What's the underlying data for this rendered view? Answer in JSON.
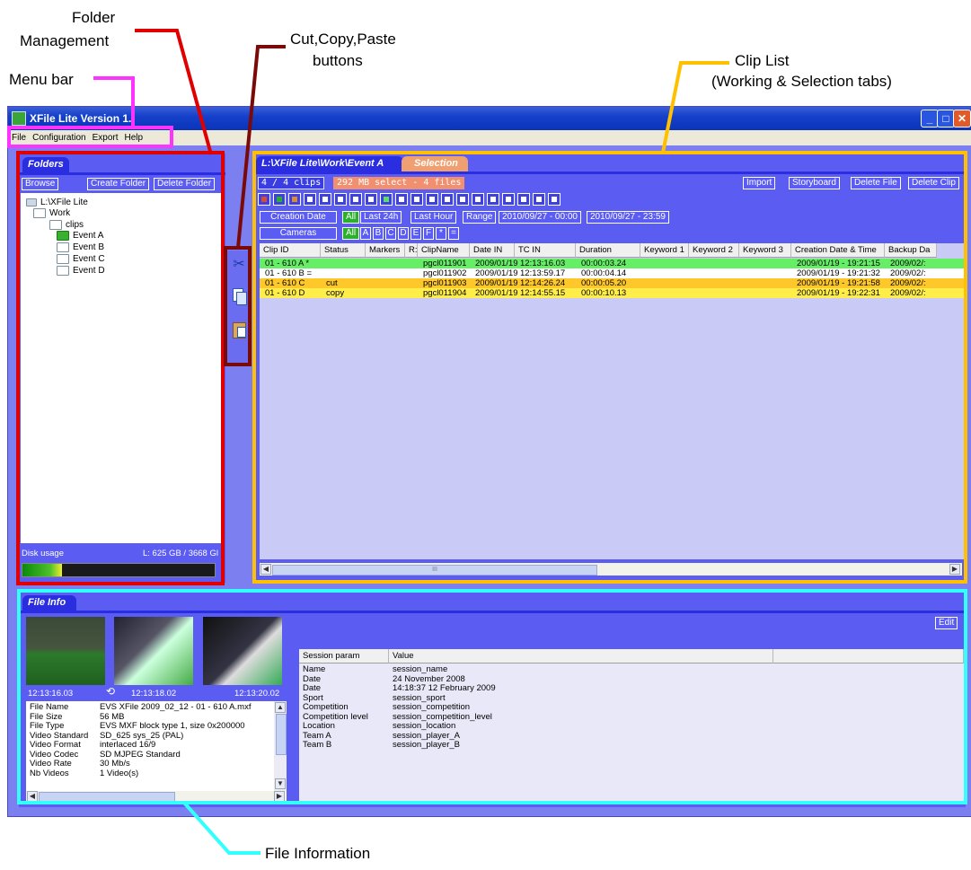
{
  "annotations": {
    "folder_management": [
      "Folder",
      "Management"
    ],
    "menu_bar": "Menu bar",
    "cut_copy_paste": [
      "Cut,Copy,Paste",
      "buttons"
    ],
    "clip_list": [
      "Clip List",
      "(Working & Selection tabs)"
    ],
    "file_information": "File Information",
    "colors": {
      "red": "#e00000",
      "magenta": "#ff33ff",
      "dark_red": "#7a0a0a",
      "orange": "#ffc000",
      "cyan": "#33ffff"
    }
  },
  "window": {
    "title": "XFile Lite   Version 1.",
    "controls": [
      "minimize-icon",
      "maximize-icon",
      "close-icon"
    ]
  },
  "menu": [
    "File",
    "Configuration",
    "Export",
    "Help"
  ],
  "folders": {
    "tab": "Folders",
    "browse_label": "Browse",
    "create_label": "Create Folder",
    "delete_label": "Delete Folder",
    "tree": {
      "root": "L:\\XFile Lite",
      "work": "Work",
      "clips": "clips",
      "event_a": "Event A",
      "event_b": "Event B",
      "event_c": "Event C",
      "event_d": "Event D"
    },
    "disk_label": "Disk usage",
    "disk_value": "L: 625 GB / 3668 Gl",
    "disk_fraction": 0.17
  },
  "clipboard": {
    "icons": [
      "scissors-icon",
      "copy-icon",
      "paste-icon"
    ]
  },
  "clip_list": {
    "working_tab": "L:\\XFile Lite\\Work\\Event A",
    "selection_tab": "Selection",
    "clip_count": "4 / 4 clips",
    "select_info": "292 MB select - 4 files",
    "import_label": "Import",
    "storyboard_label": "Storyboard",
    "delete_file_label": "Delete File",
    "delete_clip_label": "Delete Clip",
    "creation_date_label": "Creation Date",
    "cameras_label": "Cameras",
    "all_label": "All",
    "last24_label": "Last 24h",
    "lasthour_label": "Last Hour",
    "range_label": "Range",
    "range_from": "2010/09/27 - 00:00",
    "range_to": "2010/09/27 - 23:59",
    "cameras": [
      "A",
      "B",
      "C",
      "D",
      "E",
      "F",
      "*",
      "="
    ],
    "columns": [
      "Clip ID",
      "Status",
      "Markers",
      "R:",
      "ClipName",
      "Date IN",
      "TC IN",
      "Duration",
      "Keyword 1",
      "Keyword 2",
      "Keyword 3",
      "Creation Date & Time",
      "Backup Da"
    ],
    "rows": [
      {
        "id": "01 - 610 A *",
        "status": "",
        "name": "pgcl011901",
        "date": "2009/01/19",
        "tc": "12:13:16.03",
        "dur": "00:00:03.24",
        "created": "2009/01/19 - 19:21:15",
        "backup": "2009/02/:",
        "color": "#66ee66"
      },
      {
        "id": "01 - 610 B =",
        "status": "",
        "name": "pgcl011902",
        "date": "2009/01/19",
        "tc": "12:13:59.17",
        "dur": "00:00:04.14",
        "created": "2009/01/19 - 19:21:32",
        "backup": "2009/02/:",
        "color": "#ffffff"
      },
      {
        "id": "01 - 610 C",
        "status": "cut",
        "name": "pgcl011903",
        "date": "2009/01/19",
        "tc": "12:14:26.24",
        "dur": "00:00:05.20",
        "created": "2009/01/19 - 19:21:58",
        "backup": "2009/02/:",
        "color": "#ffc82a"
      },
      {
        "id": "01 - 610 D",
        "status": "copy",
        "name": "pgcl011904",
        "date": "2009/01/19",
        "tc": "12:14:55.15",
        "dur": "00:00:10.13",
        "created": "2009/01/19 - 19:22:31",
        "backup": "2009/02/:",
        "color": "#ffee4a"
      }
    ],
    "scroll_mark": "III"
  },
  "file_info": {
    "tab": "File Info",
    "edit_label": "Edit",
    "timecodes": [
      "12:13:16.03",
      "12:13:18.02",
      "12:13:20.02"
    ],
    "props": [
      {
        "k": "File Name",
        "v": "EVS XFile 2009_02_12 - 01 - 610 A.mxf"
      },
      {
        "k": "File Size",
        "v": "56 MB"
      },
      {
        "k": "File Type",
        "v": "EVS MXF block type 1, size 0x200000"
      },
      {
        "k": "Video Standard",
        "v": "SD_625 sys_25 (PAL)"
      },
      {
        "k": "Video Format",
        "v": "interlaced 16/9"
      },
      {
        "k": "Video Codec",
        "v": "SD MJPEG Standard"
      },
      {
        "k": "Video Rate",
        "v": "30 Mb/s"
      },
      {
        "k": "Nb Videos",
        "v": "1 Video(s)"
      }
    ],
    "session_headers": [
      "Session param",
      "Value"
    ],
    "session": [
      {
        "k": "Name",
        "v": "session_name"
      },
      {
        "k": "Date",
        "v": "24 November 2008"
      },
      {
        "k": "Date",
        "v": "14:18:37   12 February 2009"
      },
      {
        "k": "Sport",
        "v": "session_sport"
      },
      {
        "k": "Competition",
        "v": "session_competition"
      },
      {
        "k": "Competition level",
        "v": "session_competition_level"
      },
      {
        "k": "Location",
        "v": "session_location"
      },
      {
        "k": "Team A",
        "v": "session_player_A"
      },
      {
        "k": "Team B",
        "v": "session_player_B"
      }
    ]
  }
}
